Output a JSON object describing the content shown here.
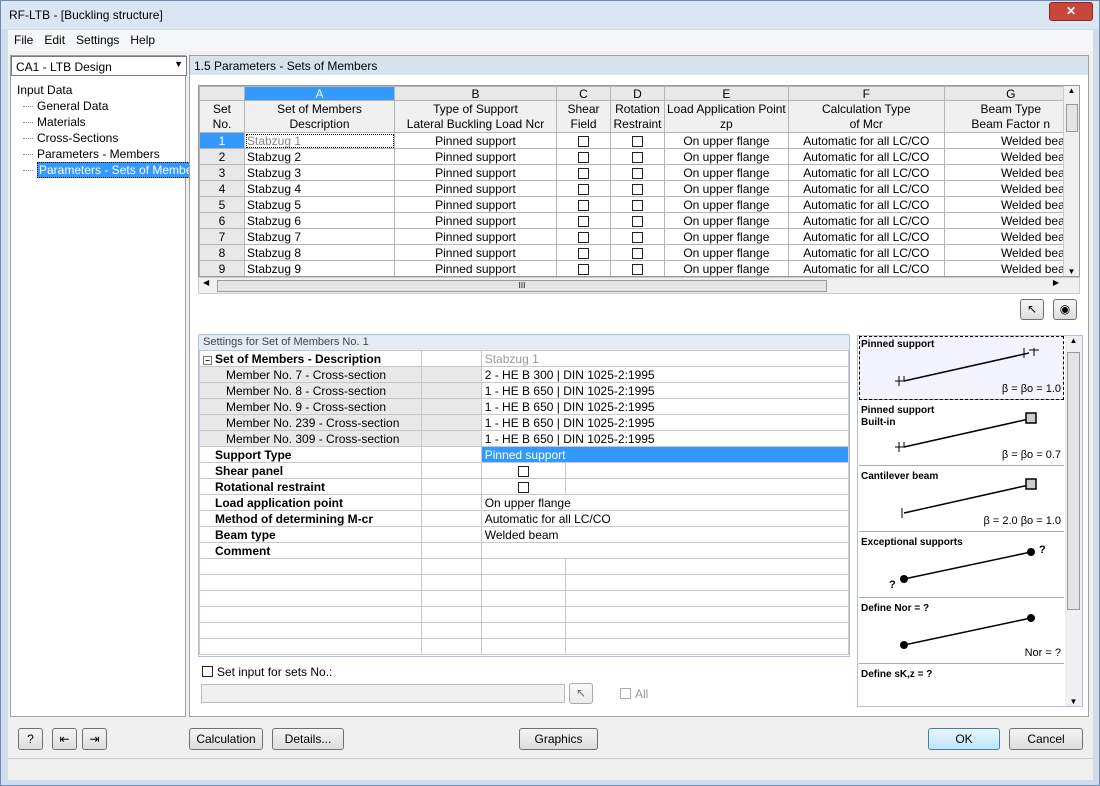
{
  "window": {
    "title": "RF-LTB - [Buckling structure]",
    "close_icon": "close-icon"
  },
  "menu": [
    "File",
    "Edit",
    "Settings",
    "Help"
  ],
  "case_select": "CA1 - LTB Design",
  "tree": {
    "root": "Input Data",
    "items": [
      "General Data",
      "Materials",
      "Cross-Sections",
      "Parameters - Members",
      "Parameters - Sets of Members"
    ],
    "selected": 4
  },
  "section_title": "1.5 Parameters - Sets of Members",
  "grid": {
    "letters": [
      "A",
      "B",
      "C",
      "D",
      "E",
      "F",
      "G"
    ],
    "headers": [
      [
        "Set",
        "No."
      ],
      [
        "Set of Members",
        "Description"
      ],
      [
        "Type of Support",
        "Lateral Buckling Load Ncr"
      ],
      [
        "Shear",
        "Field"
      ],
      [
        "Rotation",
        "Restraint"
      ],
      [
        "Load Application Point",
        "zp"
      ],
      [
        "Calculation Type",
        "of Mcr"
      ],
      [
        "Beam Type",
        "Beam Factor n"
      ]
    ],
    "rows": [
      {
        "no": "1",
        "desc": "Stabzug 1",
        "support": "Pinned support",
        "shear": false,
        "rot": false,
        "load": "On upper flange",
        "calc": "Automatic for all LC/CO",
        "beam": "Welded beam"
      },
      {
        "no": "2",
        "desc": "Stabzug 2",
        "support": "Pinned support",
        "shear": false,
        "rot": false,
        "load": "On upper flange",
        "calc": "Automatic for all LC/CO",
        "beam": "Welded beam"
      },
      {
        "no": "3",
        "desc": "Stabzug 3",
        "support": "Pinned support",
        "shear": false,
        "rot": false,
        "load": "On upper flange",
        "calc": "Automatic for all LC/CO",
        "beam": "Welded beam"
      },
      {
        "no": "4",
        "desc": "Stabzug 4",
        "support": "Pinned support",
        "shear": false,
        "rot": false,
        "load": "On upper flange",
        "calc": "Automatic for all LC/CO",
        "beam": "Welded beam"
      },
      {
        "no": "5",
        "desc": "Stabzug 5",
        "support": "Pinned support",
        "shear": false,
        "rot": false,
        "load": "On upper flange",
        "calc": "Automatic for all LC/CO",
        "beam": "Welded beam"
      },
      {
        "no": "6",
        "desc": "Stabzug 6",
        "support": "Pinned support",
        "shear": false,
        "rot": false,
        "load": "On upper flange",
        "calc": "Automatic for all LC/CO",
        "beam": "Welded beam"
      },
      {
        "no": "7",
        "desc": "Stabzug 7",
        "support": "Pinned support",
        "shear": false,
        "rot": false,
        "load": "On upper flange",
        "calc": "Automatic for all LC/CO",
        "beam": "Welded beam"
      },
      {
        "no": "8",
        "desc": "Stabzug 8",
        "support": "Pinned support",
        "shear": false,
        "rot": false,
        "load": "On upper flange",
        "calc": "Automatic for all LC/CO",
        "beam": "Welded beam"
      },
      {
        "no": "9",
        "desc": "Stabzug 9",
        "support": "Pinned support",
        "shear": false,
        "rot": false,
        "load": "On upper flange",
        "calc": "Automatic for all LC/CO",
        "beam": "Welded beam"
      }
    ]
  },
  "settings": {
    "title": "Settings for Set of Members No. 1",
    "group": "Set of Members - Description",
    "group_value": "Stabzug 1",
    "members": [
      {
        "label": "Member No. 7 - Cross-section",
        "value": "2 - HE B 300 | DIN 1025-2:1995"
      },
      {
        "label": "Member No. 8 - Cross-section",
        "value": "1 - HE B 650 | DIN 1025-2:1995"
      },
      {
        "label": "Member No. 9 - Cross-section",
        "value": "1 - HE B 650 | DIN 1025-2:1995"
      },
      {
        "label": "Member No. 239 - Cross-section",
        "value": "1 - HE B 650 | DIN 1025-2:1995"
      },
      {
        "label": "Member No. 309 - Cross-section",
        "value": "1 - HE B 650 | DIN 1025-2:1995"
      }
    ],
    "props": [
      {
        "label": "Support Type",
        "value": "Pinned support",
        "type": "text",
        "hl": true
      },
      {
        "label": "Shear panel",
        "checked": false,
        "type": "check"
      },
      {
        "label": "Rotational restraint",
        "checked": false,
        "type": "check"
      },
      {
        "label": "Load application point",
        "value": "On upper flange",
        "type": "text"
      },
      {
        "label": "Method of determining M-cr",
        "value": "Automatic for all LC/CO",
        "type": "text"
      },
      {
        "label": "Beam type",
        "value": "Welded beam",
        "type": "text"
      },
      {
        "label": "Comment",
        "value": "",
        "type": "text"
      }
    ],
    "set_input_label": "Set input for sets No.:",
    "set_input_value": "",
    "all_label": "All"
  },
  "pictures": [
    {
      "title": "Pinned support",
      "formula": "β = βo = 1.0"
    },
    {
      "title": "Pinned support\nBuilt-in",
      "formula": "β = βo = 0.7"
    },
    {
      "title": "Cantilever beam",
      "formula": "β = 2.0    βo = 1.0"
    },
    {
      "title": "Exceptional supports",
      "formula": ""
    },
    {
      "title": "Define Nor = ?",
      "formula": "Nor = ?"
    },
    {
      "title": "Define sK,z = ?",
      "formula": ""
    }
  ],
  "buttons": {
    "calculation": "Calculation",
    "details": "Details...",
    "graphics": "Graphics",
    "ok": "OK",
    "cancel": "Cancel"
  },
  "colors": {
    "selection": "#3399ff",
    "header_band": "#d6e2f0"
  }
}
